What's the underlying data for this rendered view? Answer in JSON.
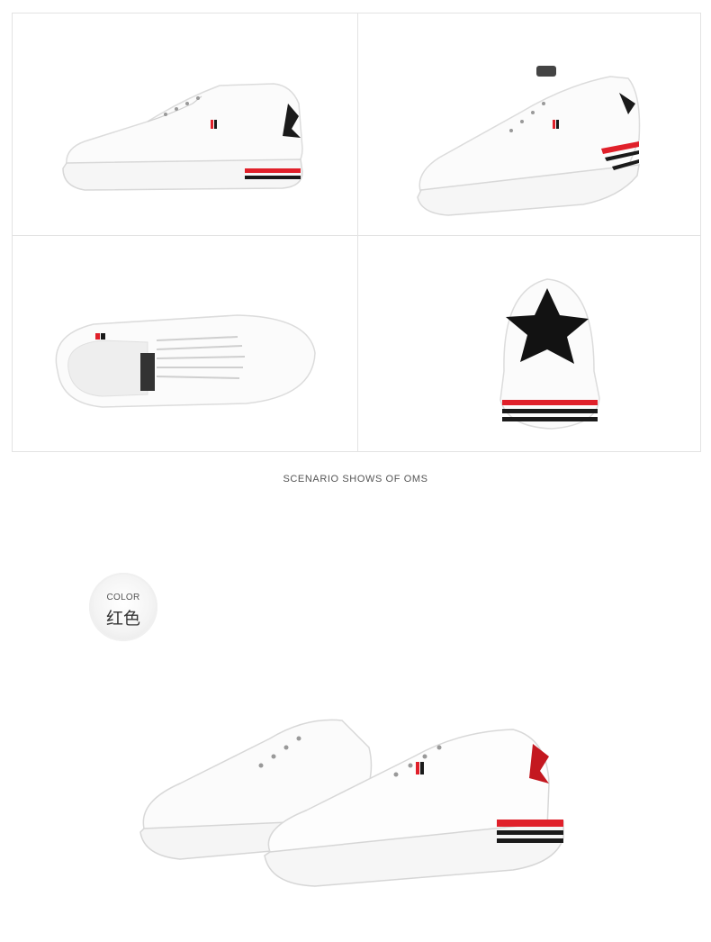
{
  "caption": "SCENARIO SHOWS OF OMS",
  "color_badge": {
    "label_en": "COLOR",
    "label_cn": "红色"
  },
  "colors": {
    "stripe_red": "#e0202a",
    "stripe_black": "#1a1a1a",
    "shoe_white": "#ffffff",
    "grid_border": "#e3e3e3"
  },
  "product_views": [
    "side-view",
    "three-quarter-rear-view",
    "top-view",
    "heel-view"
  ],
  "scene": "pair-of-white-sneakers"
}
